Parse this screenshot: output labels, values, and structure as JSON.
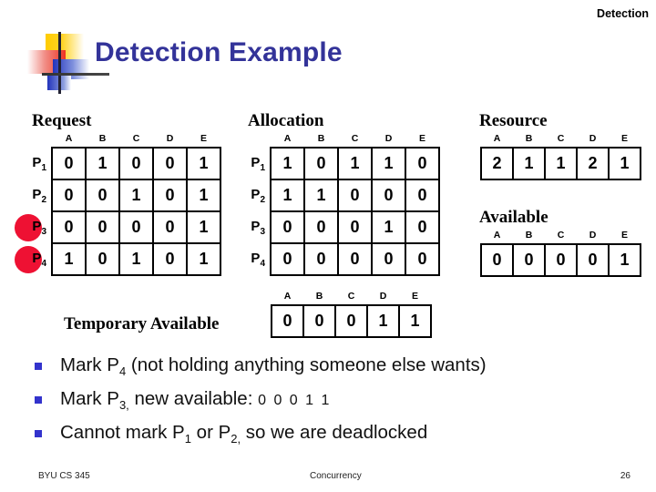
{
  "header": {
    "corner_label": "Detection",
    "title": "Detection Example",
    "title_color": "#333399",
    "logo_name": "powerpoint-design-logo"
  },
  "columns": [
    "A",
    "B",
    "C",
    "D",
    "E"
  ],
  "request": {
    "caption": "Request",
    "columns": [
      "A",
      "B",
      "C",
      "D",
      "E"
    ],
    "rows": [
      {
        "label": "P",
        "sub": "1",
        "marked": false,
        "values": [
          "0",
          "1",
          "0",
          "0",
          "1"
        ]
      },
      {
        "label": "P",
        "sub": "2",
        "marked": false,
        "values": [
          "0",
          "0",
          "1",
          "0",
          "1"
        ]
      },
      {
        "label": "P",
        "sub": "3",
        "marked": true,
        "values": [
          "0",
          "0",
          "0",
          "0",
          "1"
        ]
      },
      {
        "label": "P",
        "sub": "4",
        "marked": true,
        "values": [
          "1",
          "0",
          "1",
          "0",
          "1"
        ]
      }
    ]
  },
  "allocation": {
    "caption": "Allocation",
    "columns": [
      "A",
      "B",
      "C",
      "D",
      "E"
    ],
    "rows": [
      {
        "label": "P",
        "sub": "1",
        "marked": false,
        "values": [
          "1",
          "0",
          "1",
          "1",
          "0"
        ]
      },
      {
        "label": "P",
        "sub": "2",
        "marked": false,
        "values": [
          "1",
          "1",
          "0",
          "0",
          "0"
        ]
      },
      {
        "label": "P",
        "sub": "3",
        "marked": false,
        "values": [
          "0",
          "0",
          "0",
          "1",
          "0"
        ]
      },
      {
        "label": "P",
        "sub": "4",
        "marked": false,
        "values": [
          "0",
          "0",
          "0",
          "0",
          "0"
        ]
      }
    ]
  },
  "resource": {
    "caption": "Resource",
    "columns": [
      "A",
      "B",
      "C",
      "D",
      "E"
    ],
    "values": [
      "2",
      "1",
      "1",
      "2",
      "1"
    ]
  },
  "available": {
    "caption": "Available",
    "columns": [
      "A",
      "B",
      "C",
      "D",
      "E"
    ],
    "values": [
      "0",
      "0",
      "0",
      "0",
      "1"
    ]
  },
  "temporary_available": {
    "caption": "Temporary Available",
    "columns": [
      "A",
      "B",
      "C",
      "D",
      "E"
    ],
    "values": [
      "0",
      "0",
      "0",
      "1",
      "1"
    ]
  },
  "bullets": [
    {
      "pre": "Mark P",
      "sub": "4",
      "post": " (not holding anything someone else wants)",
      "vector": ""
    },
    {
      "pre": "Mark P",
      "sub": "3,",
      "post": " new available: ",
      "vector": "0 0 0 1 1"
    },
    {
      "pre": "Cannot mark P",
      "sub": "1",
      "post": " or P",
      "sub2": "2,",
      "post2": " so we are deadlocked",
      "vector": ""
    }
  ],
  "bullet_color": "#3333cc",
  "mark_circle_color": "#ee1133",
  "footer": {
    "left": "BYU CS 345",
    "center": "Concurrency",
    "right": "26"
  }
}
